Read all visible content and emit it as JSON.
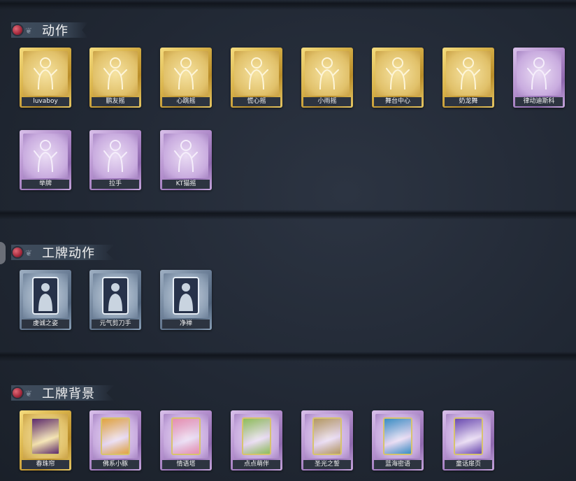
{
  "sections": [
    {
      "title": "动作",
      "items": [
        {
          "label": "luvaboy",
          "rarity": "gold",
          "icon": "pose-figure-icon"
        },
        {
          "label": "鹏友摇",
          "rarity": "gold",
          "icon": "pose-figure-icon"
        },
        {
          "label": "心跳摇",
          "rarity": "gold",
          "icon": "pose-figure-icon"
        },
        {
          "label": "慌心摇",
          "rarity": "gold",
          "icon": "pose-figure-icon"
        },
        {
          "label": "小雨摇",
          "rarity": "gold",
          "icon": "pose-figure-icon"
        },
        {
          "label": "舞台中心",
          "rarity": "gold",
          "icon": "pose-figure-icon"
        },
        {
          "label": "奶龙舞",
          "rarity": "gold",
          "icon": "pose-figure-icon"
        },
        {
          "label": "律动迪斯科",
          "rarity": "purple",
          "icon": "pose-figure-icon"
        },
        {
          "label": "举牌",
          "rarity": "purple",
          "icon": "sign-icon"
        },
        {
          "label": "拉手",
          "rarity": "purple",
          "icon": "pose-figure-icon"
        },
        {
          "label": "KT猫摇",
          "rarity": "purple",
          "icon": "pose-figure-icon"
        }
      ]
    },
    {
      "title": "工牌动作",
      "items": [
        {
          "label": "虔诚之姿",
          "rarity": "blue",
          "icon": "badge-pose-icon"
        },
        {
          "label": "元气剪刀手",
          "rarity": "blue",
          "icon": "badge-pose-icon"
        },
        {
          "label": "净禅",
          "rarity": "blue",
          "icon": "badge-pose-icon"
        }
      ]
    },
    {
      "title": "工牌背景",
      "items": [
        {
          "label": "春珠帘",
          "rarity": "gold",
          "icon": "card-background-icon",
          "art_color": "#5b2a6e"
        },
        {
          "label": "佛系小豚",
          "rarity": "purple",
          "icon": "card-background-icon",
          "art_color": "#e2a53f"
        },
        {
          "label": "情语塔",
          "rarity": "purple",
          "icon": "card-background-icon",
          "art_color": "#e78fb0"
        },
        {
          "label": "点点萌伴",
          "rarity": "purple",
          "icon": "card-background-icon",
          "art_color": "#8fbf5a"
        },
        {
          "label": "圣光之誓",
          "rarity": "purple",
          "icon": "card-background-icon",
          "art_color": "#b59a62"
        },
        {
          "label": "蓝海密语",
          "rarity": "purple",
          "icon": "card-background-icon",
          "art_color": "#3a8fc4"
        },
        {
          "label": "童话扉页",
          "rarity": "purple",
          "icon": "card-background-icon",
          "art_color": "#6a4bb0"
        }
      ]
    }
  ]
}
